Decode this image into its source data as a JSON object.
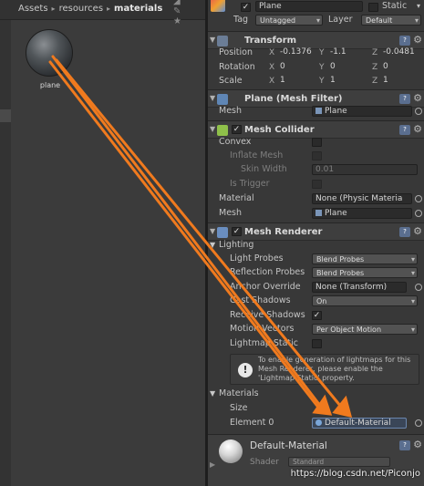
{
  "project": {
    "breadcrumb": [
      "Assets",
      "resources",
      "materials"
    ],
    "asset": {
      "name": "plane",
      "icon": "material-sphere-icon"
    }
  },
  "inspector": {
    "object": {
      "name": "Plane",
      "static_label": "Static",
      "tag_label": "Tag",
      "tag_value": "Untagged",
      "layer_label": "Layer",
      "layer_value": "Default"
    },
    "transform": {
      "title": "Transform",
      "position": {
        "label": "Position",
        "x": "-0.1376",
        "y": "-1.1",
        "z": "-0.0481"
      },
      "rotation": {
        "label": "Rotation",
        "x": "0",
        "y": "0",
        "z": "0"
      },
      "scale": {
        "label": "Scale",
        "x": "1",
        "y": "1",
        "z": "1"
      }
    },
    "mesh_filter": {
      "title": "Plane (Mesh Filter)",
      "mesh_label": "Mesh",
      "mesh_value": "Plane"
    },
    "mesh_collider": {
      "title": "Mesh Collider",
      "convex": "Convex",
      "inflate_mesh": "Inflate Mesh",
      "skin_width_label": "Skin Width",
      "skin_width_value": "0.01",
      "is_trigger": "Is Trigger",
      "material_label": "Material",
      "material_value": "None (Physic Materia",
      "mesh_label": "Mesh",
      "mesh_value": "Plane"
    },
    "mesh_renderer": {
      "title": "Mesh Renderer",
      "lighting_label": "Lighting",
      "light_probes_label": "Light Probes",
      "light_probes_value": "Blend Probes",
      "reflection_probes_label": "Reflection Probes",
      "reflection_probes_value": "Blend Probes",
      "anchor_override_label": "Anchor Override",
      "anchor_override_value": "None (Transform)",
      "cast_shadows_label": "Cast Shadows",
      "cast_shadows_value": "On",
      "receive_shadows_label": "Receive Shadows",
      "motion_vectors_label": "Motion Vectors",
      "motion_vectors_value": "Per Object Motion",
      "lightmap_static_label": "Lightmap Static",
      "info_text": "To enable generation of lightmaps for this Mesh Renderer, please enable the 'Lightmap Static' property.",
      "materials_label": "Materials",
      "size_label": "Size",
      "element0_label": "Element 0",
      "element0_value": "Default-Material"
    },
    "material": {
      "name": "Default-Material",
      "shader_label": "Shader",
      "shader_value": "Standard"
    }
  },
  "watermark": "https://blog.csdn.net/Piconjo",
  "colors": {
    "arrow": "#f07a1e",
    "panel_bg": "#383838",
    "project_bg": "#3b3b3b"
  }
}
